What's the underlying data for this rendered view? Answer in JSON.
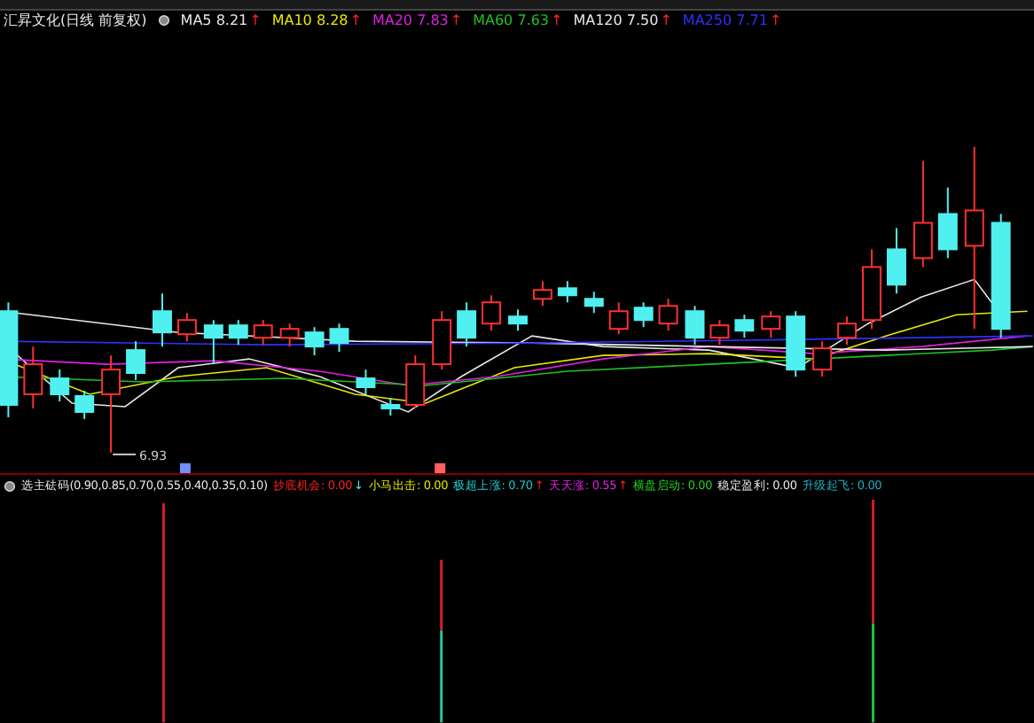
{
  "title": "汇昇文化(日线 前复权)",
  "ma_readings": [
    {
      "label": "MA5",
      "value": "8.21",
      "arrow": "↑",
      "color": "#e8e8e8"
    },
    {
      "label": "MA10",
      "value": "8.28",
      "arrow": "↑",
      "color": "#e8e800"
    },
    {
      "label": "MA20",
      "value": "7.83",
      "arrow": "↑",
      "color": "#e020e0"
    },
    {
      "label": "MA60",
      "value": "7.63",
      "arrow": "↑",
      "color": "#20c020"
    },
    {
      "label": "MA120",
      "value": "7.50",
      "arrow": "↑",
      "color": "#e8e8e8"
    },
    {
      "label": "MA250",
      "value": "7.71",
      "arrow": "↑",
      "color": "#3030ff"
    }
  ],
  "price_low_label": "6.93",
  "indicator": {
    "name": "选主砝码(0.90,0.85,0.70,0.55,0.40,0.35,0.10)",
    "readings": [
      {
        "label": "抄底机会:",
        "value": "0.00",
        "arrow": "↓",
        "color": "#ff2020"
      },
      {
        "label": "小马出击:",
        "value": "0.00",
        "color": "#e8e800"
      },
      {
        "label": "极超上涨:",
        "value": "0.70",
        "arrow": "↑",
        "color": "#20c8c8"
      },
      {
        "label": "天天涨:",
        "value": "0.55",
        "arrow": "↑",
        "color": "#e020e0"
      },
      {
        "label": "横盘启动:",
        "value": "0.00",
        "color": "#20d020"
      },
      {
        "label": "稳定盈利:",
        "value": "0.00",
        "color": "#e8e8e8"
      },
      {
        "label": "升级起飞:",
        "value": "0.00",
        "color": "#20b0c0"
      }
    ]
  }
}
